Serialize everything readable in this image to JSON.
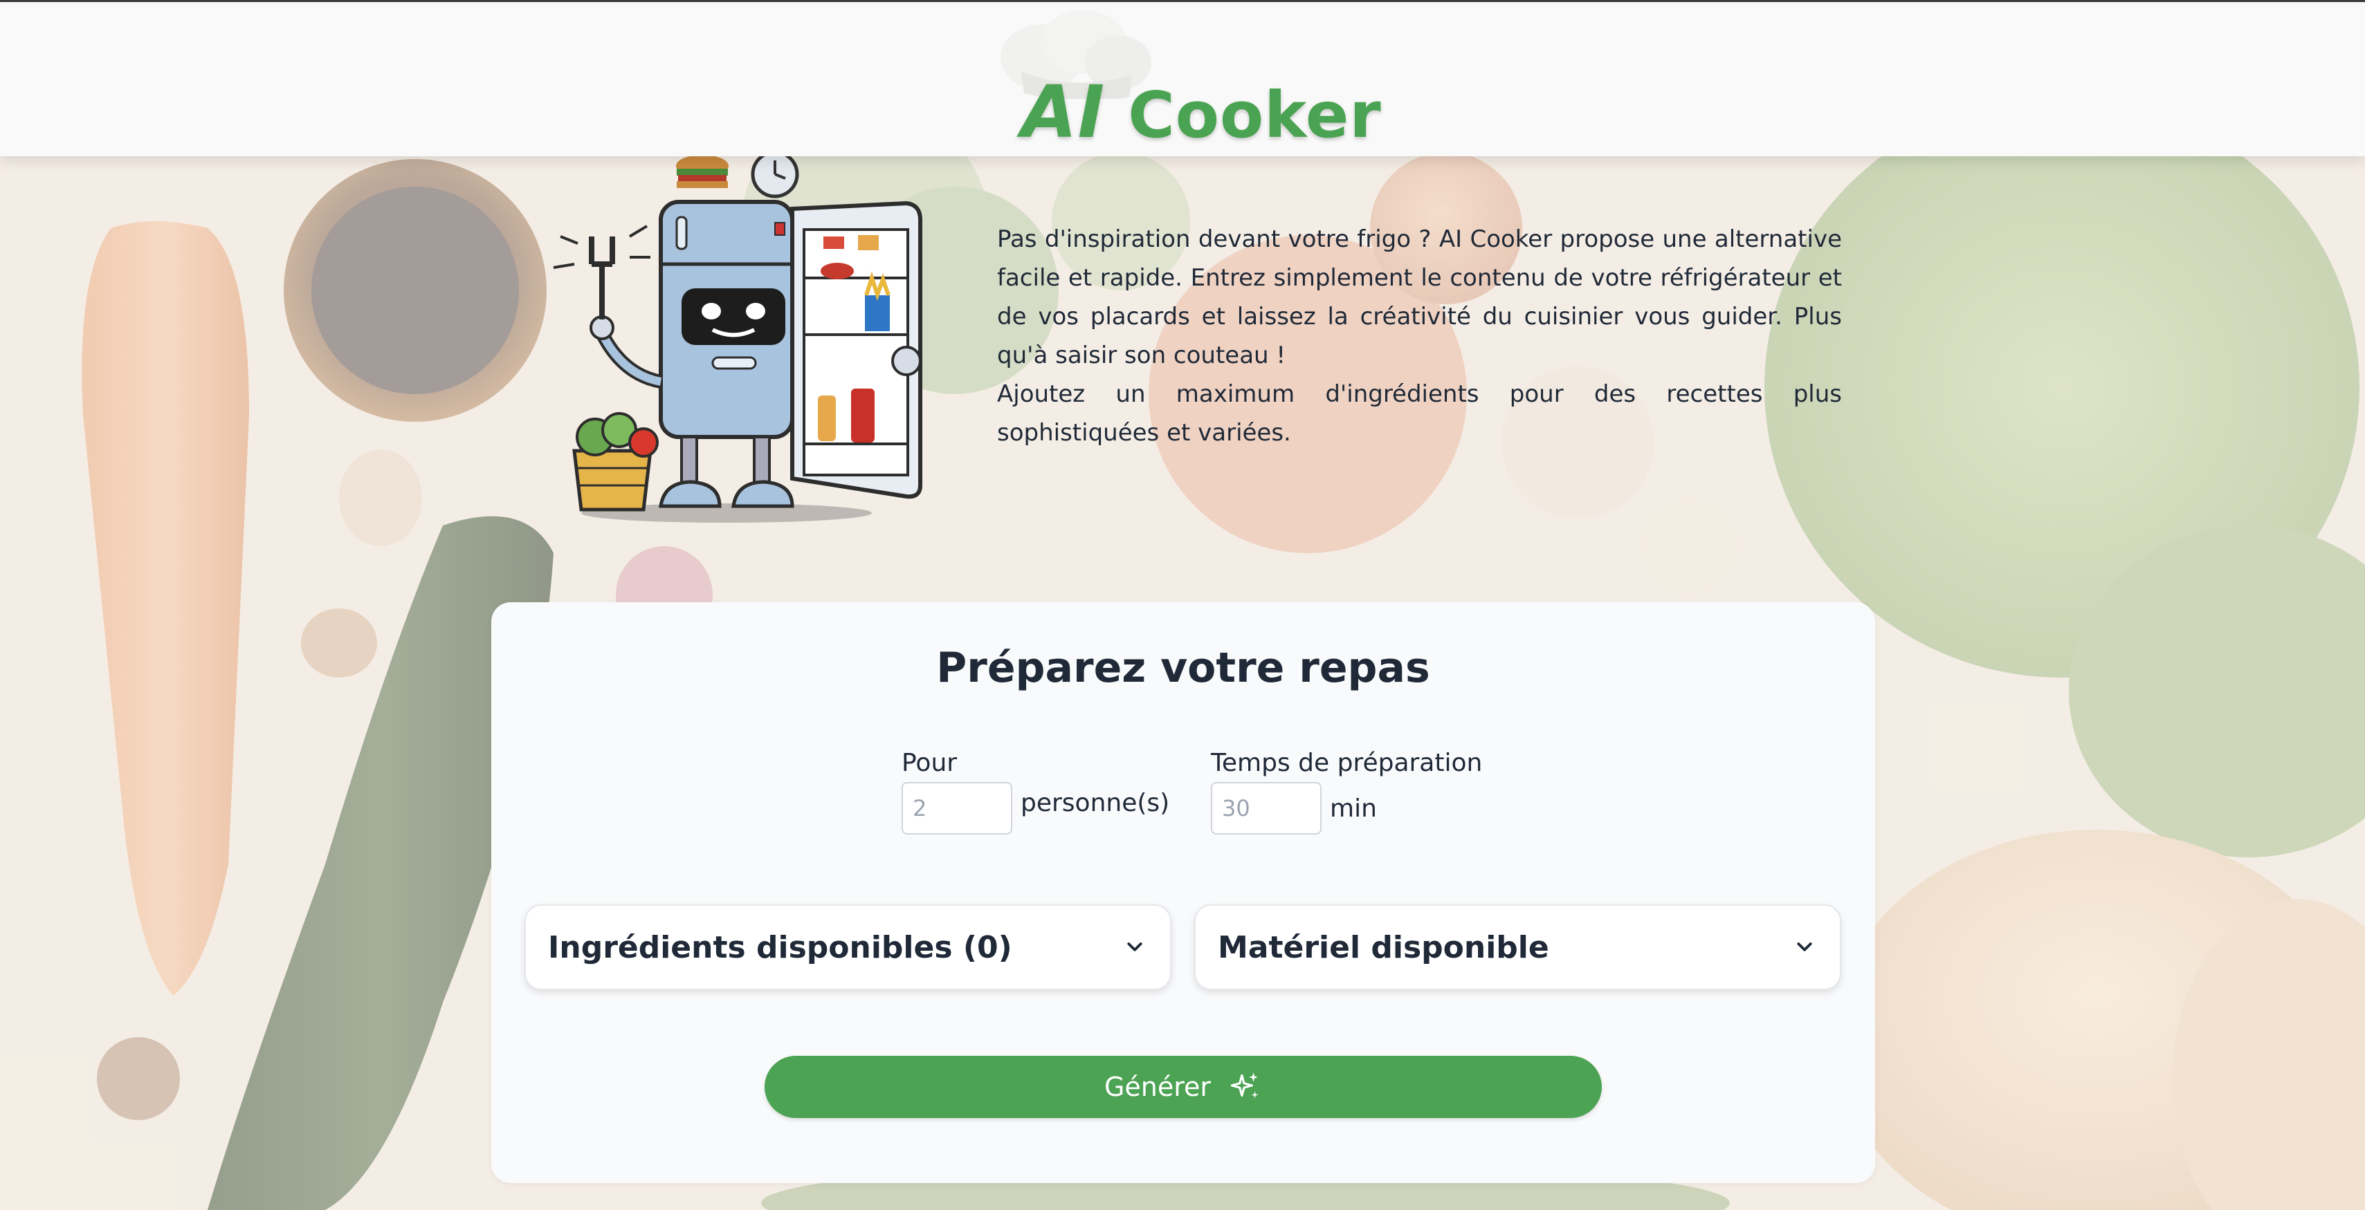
{
  "header": {
    "logo_text_ai": "AI",
    "logo_text_rest": "Cooker"
  },
  "intro": {
    "paragraph1": "Pas d'inspiration devant votre frigo ? AI Cooker propose une alternative facile et rapide. Entrez simplement le contenu de votre réfrigérateur et de vos placards et laissez la créativité du cuisinier vous guider. Plus qu'à saisir son couteau !",
    "paragraph2": "Ajoutez un maximum d'ingrédients pour des recettes plus sophistiquées et variées."
  },
  "form": {
    "title": "Préparez votre repas",
    "servings": {
      "label": "Pour",
      "placeholder": "2",
      "unit": "personne(s)"
    },
    "prep_time": {
      "label": "Temps de préparation",
      "placeholder": "30",
      "unit": "min"
    },
    "ingredients_label": "Ingrédients disponibles (0)",
    "equipment_label": "Matériel disponible",
    "generate_label": "Générer"
  },
  "colors": {
    "brand_green": "#4ca354",
    "text_dark": "#1f2937",
    "card_bg": "#f9fafb",
    "header_bg": "#f9f9f9"
  },
  "icons": {
    "logo": "chef-hat-icon",
    "accordion": "chevron-down-icon",
    "generate": "sparkles-icon",
    "mascot": "robot-fridge-illustration"
  }
}
